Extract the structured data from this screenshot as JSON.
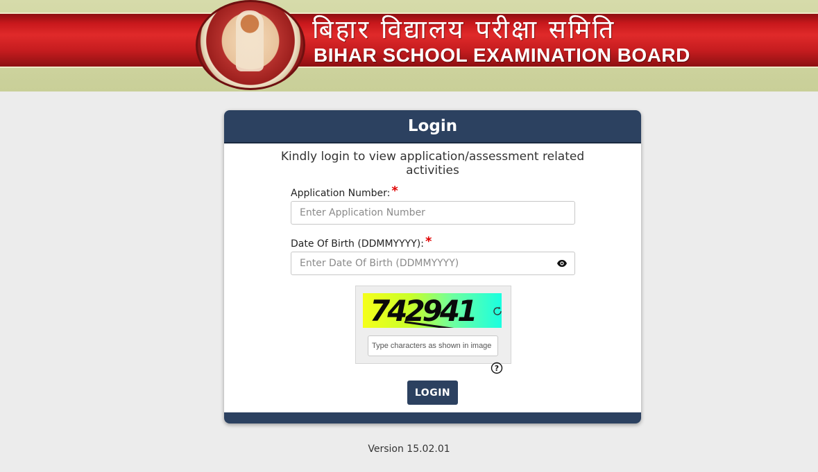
{
  "header": {
    "title_hindi": "बिहार विद्यालय परीक्षा समिति",
    "title_english": "BIHAR SCHOOL EXAMINATION BOARD",
    "logo_icon": "bseb-seal-logo"
  },
  "login": {
    "title": "Login",
    "intro": "Kindly login to view application/assessment related activities",
    "application_number": {
      "label": "Application Number:",
      "required_mark": "*",
      "placeholder": "Enter Application Number",
      "value": ""
    },
    "dob": {
      "label": "Date Of Birth (DDMMYYYY):",
      "required_mark": "*",
      "placeholder": "Enter Date Of Birth (DDMMYYYY)",
      "value": "",
      "toggle_icon": "eye-icon"
    },
    "captcha": {
      "text": "742941",
      "placeholder": "Type characters as shown in image",
      "refresh_icon": "refresh-icon",
      "help_icon": "help-icon"
    },
    "submit_label": "LOGIN"
  },
  "footer": {
    "version": "Version 15.02.01"
  },
  "colors": {
    "primary": "#2c4160",
    "required": "#e00000",
    "banner_red": "#c8181c"
  }
}
